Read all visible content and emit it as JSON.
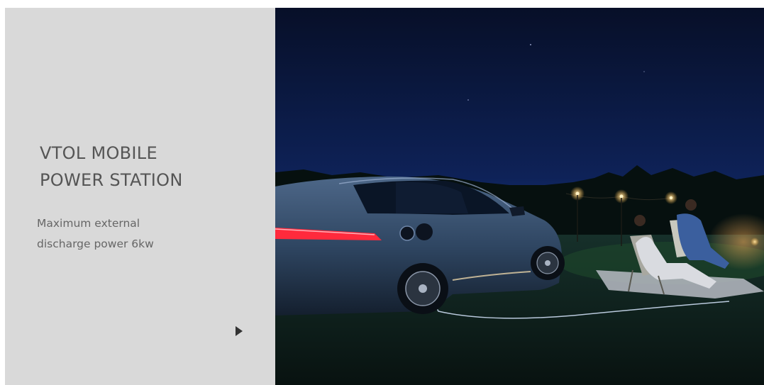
{
  "slide": {
    "title_lines": [
      "VTOL MOBILE",
      "POWER STATION"
    ],
    "subtitle_lines": [
      "Maximum external",
      "discharge power 6kw"
    ],
    "next_icon": "play-triangle-right-icon"
  },
  "photo": {
    "subject": "car-charging-night-scene",
    "colors": {
      "sky_top": "#08112e",
      "sky_bottom": "#16307a",
      "ground": "#0b1a18",
      "car_body": "#3a5272",
      "tail_light": "#ff2a3c",
      "lamp_glow": "#ffd27a"
    }
  },
  "colors": {
    "panel_bg": "#d9d9d9",
    "title_text": "#555555",
    "subtitle_text": "#666666",
    "arrow": "#333333"
  }
}
